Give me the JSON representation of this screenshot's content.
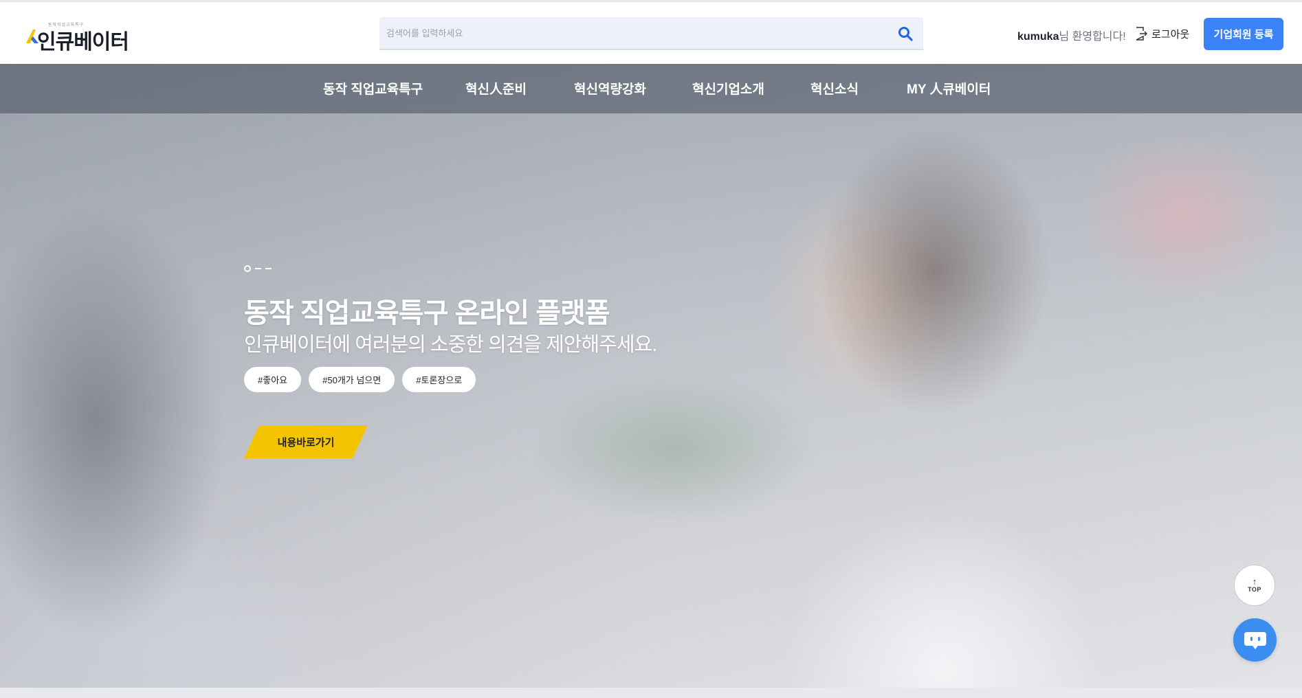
{
  "header": {
    "logo": {
      "text": "인큐베이터",
      "tagline": "동작직업교육특구"
    },
    "search": {
      "placeholder": "검색어를 입력하세요",
      "value": ""
    },
    "welcome": {
      "user": "kumuka",
      "suffix": "님 환영합니다!"
    },
    "logout_label": "로그아웃",
    "corp_register_label": "기업회원 등록",
    "accent_color": "#3b82f6"
  },
  "nav": {
    "items": [
      {
        "label": "동작 직업교육특구"
      },
      {
        "label": "혁신人준비"
      },
      {
        "label": "혁신역량강화"
      },
      {
        "label": "혁신기업소개"
      },
      {
        "label": "혁신소식"
      },
      {
        "label": "MY 人큐베이터"
      }
    ]
  },
  "hero": {
    "title": "동작 직업교육특구 온라인 플랫폼",
    "subtitle": "인큐베이터에 여러분의 소중한 의견을 제안해주세요.",
    "tags": [
      "#좋아요",
      "#50개가 넘으면",
      "#토론장으로"
    ],
    "cta_label": "내용바로가기",
    "cta_color": "#f5c400",
    "slides": {
      "current": 1,
      "total": 3
    }
  },
  "floating": {
    "top_label": "TOP",
    "top_arrow": "↑",
    "chat_icon": "chatbot-icon",
    "chat_color": "#3c8df0"
  }
}
